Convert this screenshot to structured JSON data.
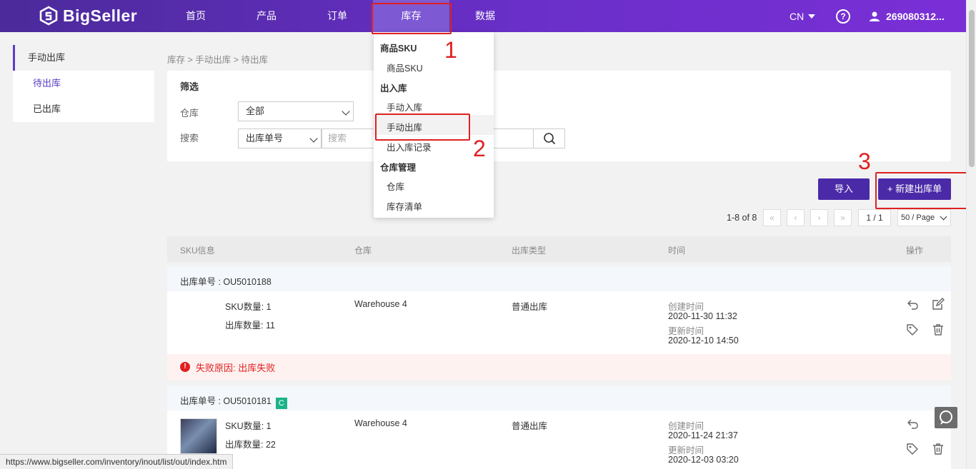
{
  "brand": {
    "name": "BigSeller"
  },
  "nav": {
    "items": [
      "首页",
      "产品",
      "订单",
      "库存",
      "数据"
    ],
    "lang": "CN",
    "user": "269080312..."
  },
  "sidebar": {
    "header": "手动出库",
    "items": [
      "待出库",
      "已出库"
    ]
  },
  "breadcrumb": "库存 > 手动出库 > 待出库",
  "filter": {
    "title": "筛选",
    "warehouse_label": "仓库",
    "warehouse_value": "全部",
    "search_label": "搜索",
    "search_type": "出库单号",
    "search_placeholder": "搜索"
  },
  "actions": {
    "import": "导入",
    "new_order": "+ 新建出库单"
  },
  "pagination": {
    "range": "1-8 of 8",
    "first": "«",
    "prev": "‹",
    "next": "›",
    "last": "»",
    "page": "1 / 1",
    "page_size": "50 / Page"
  },
  "table": {
    "headers": [
      "SKU信息",
      "仓库",
      "出库类型",
      "时间",
      "操作"
    ]
  },
  "orders": [
    {
      "order_no": "出库单号 : OU5010188",
      "sku_qty": "SKU数量: 1",
      "out_qty": "出库数量: 11",
      "warehouse": "Warehouse 4",
      "type": "普通出库",
      "created_label": "创建时间",
      "created": "2020-11-30 11:32",
      "updated_label": "更新时间",
      "updated": "2020-12-10 14:50",
      "fail": "失败原因: 出库失败"
    },
    {
      "order_no": "出库单号 : OU5010181",
      "badge": "C",
      "sku_qty": "SKU数量: 1",
      "out_qty": "出库数量: 22",
      "warehouse": "Warehouse 4",
      "type": "普通出库",
      "created_label": "创建时间",
      "created": "2020-11-24 21:37",
      "updated_label": "更新时间",
      "updated": "2020-12-03 03:20"
    }
  ],
  "dropdown": {
    "groups": [
      {
        "title": "商品SKU",
        "items": [
          "商品SKU"
        ]
      },
      {
        "title": "出入库",
        "items": [
          "手动入库",
          "手动出库",
          "出入库记录"
        ]
      },
      {
        "title": "仓库管理",
        "items": [
          "仓库",
          "库存清单"
        ]
      }
    ]
  },
  "annotations": [
    "1",
    "2",
    "3"
  ],
  "statusbar": {
    "url": "https://www.bigseller.com/inventory/inout/list/out/index.htm"
  },
  "colors": {
    "brand": "#5b33b8",
    "primary_button": "#4b2aa8",
    "annotation": "#e02020",
    "fail": "#e02020"
  }
}
